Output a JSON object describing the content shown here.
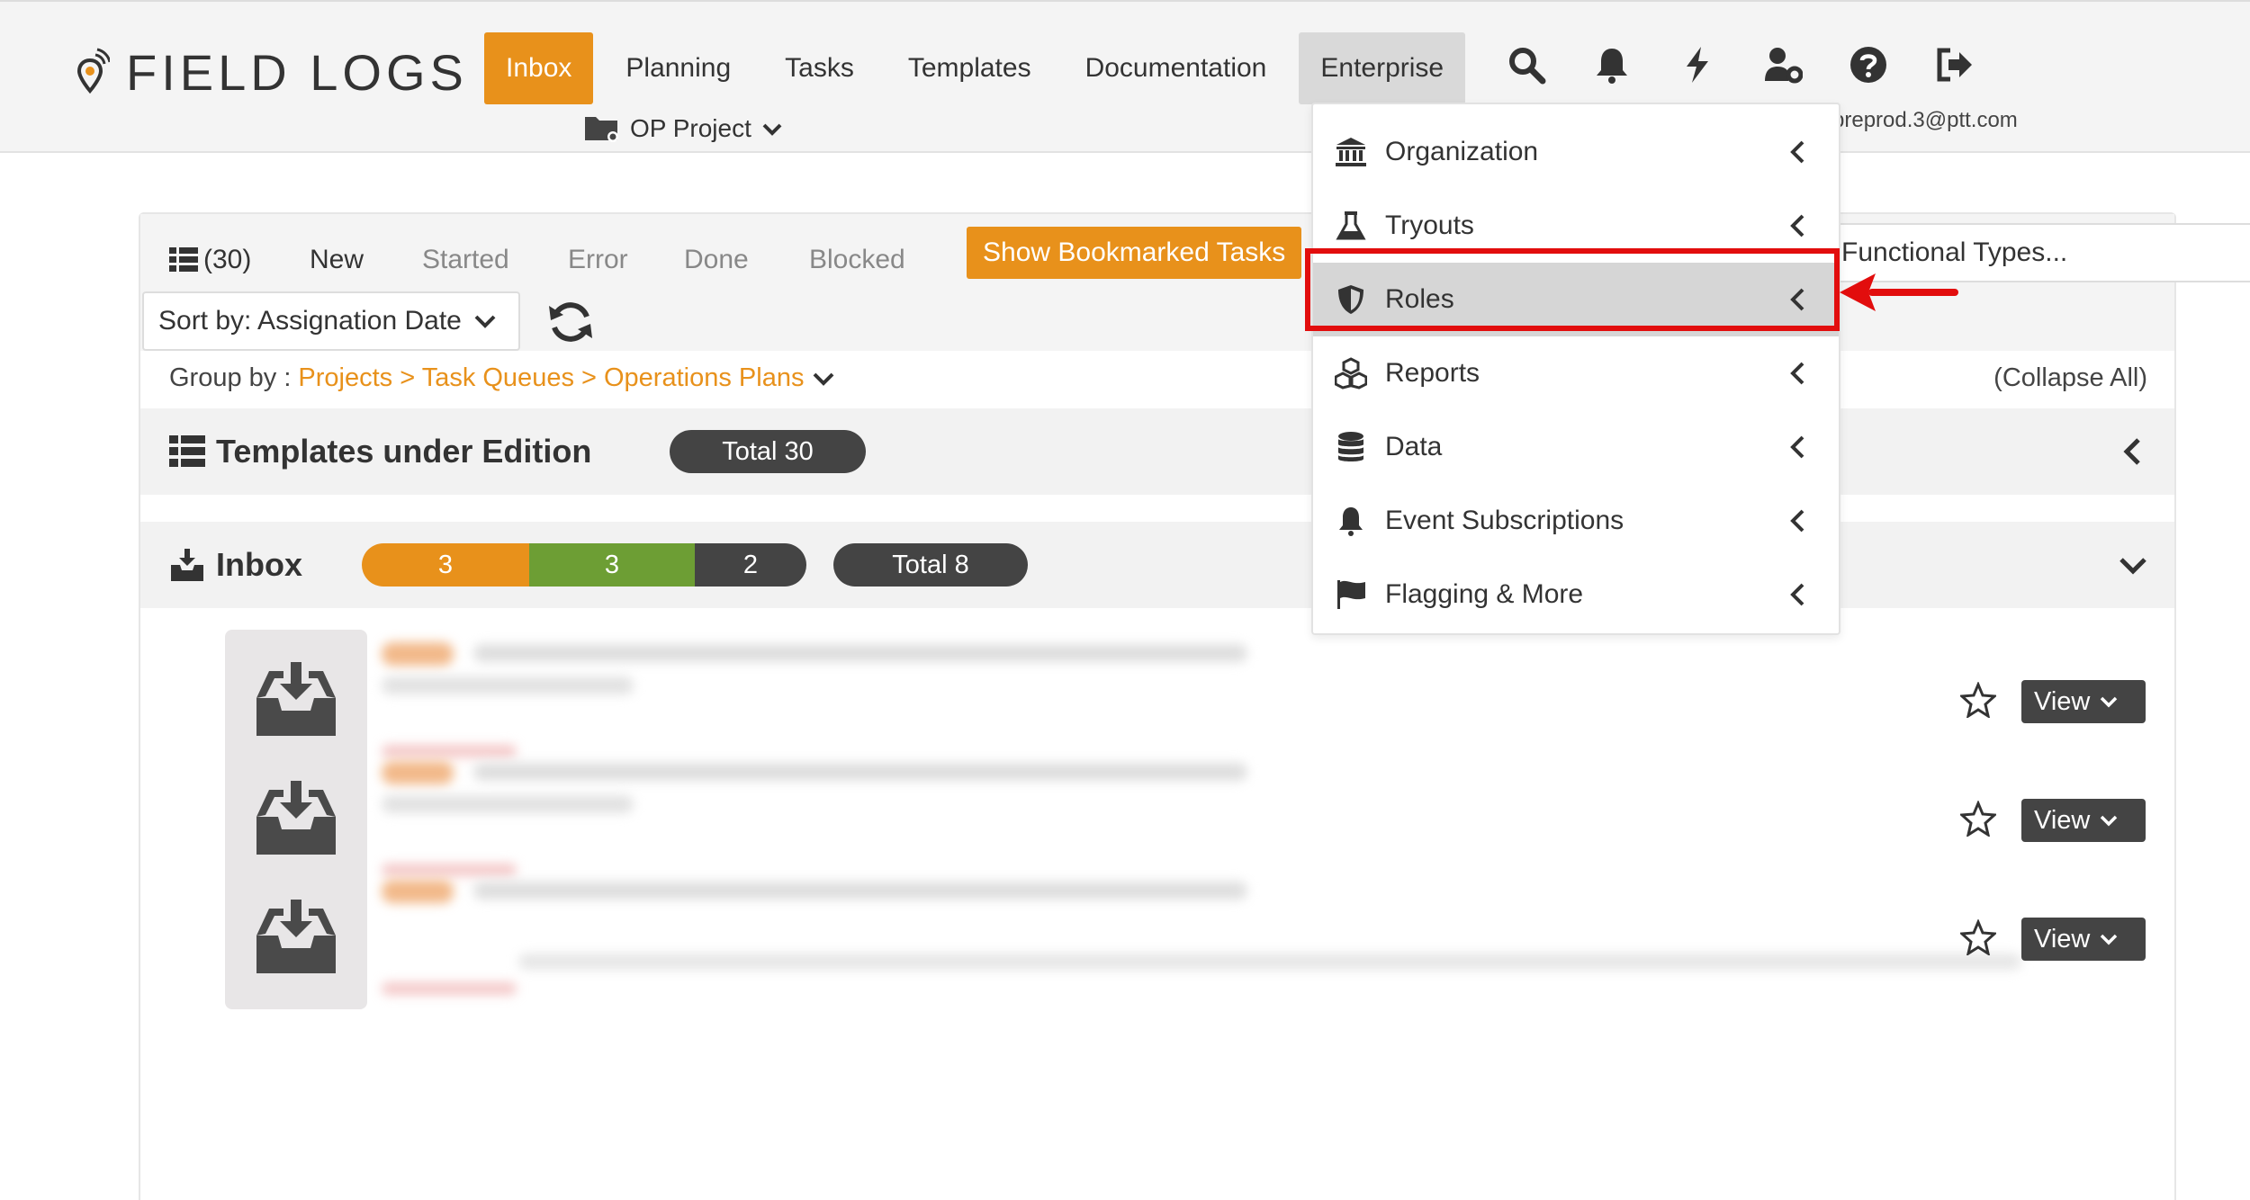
{
  "brand": {
    "name": "FIELD LOGS"
  },
  "nav": {
    "items": [
      {
        "label": "Inbox",
        "state": "active"
      },
      {
        "label": "Planning",
        "state": ""
      },
      {
        "label": "Tasks",
        "state": ""
      },
      {
        "label": "Templates",
        "state": ""
      },
      {
        "label": "Documentation",
        "state": ""
      },
      {
        "label": "Enterprise",
        "state": "open"
      }
    ],
    "icons": [
      "search-icon",
      "bell-icon",
      "bolt-icon",
      "user-settings-icon",
      "help-icon",
      "logout-icon"
    ]
  },
  "project": {
    "label": "OP Project"
  },
  "user": {
    "email_partial": "preprod.3@ptt.com"
  },
  "tabs": {
    "list_count": "(30)",
    "items": [
      "New",
      "Started",
      "Error",
      "Done",
      "Blocked"
    ],
    "active": "New",
    "bookmark_button": "Show Bookmarked Tasks",
    "functional_types": "Functional Types..."
  },
  "sort": {
    "label": "Sort by: Assignation Date"
  },
  "group_by": {
    "label": "Group by :",
    "path": "Projects > Task Queues > Operations Plans",
    "collapse_all": "(Collapse All)"
  },
  "sections": {
    "templates": {
      "title": "Templates under Edition",
      "total": "Total 30"
    },
    "inbox": {
      "title": "Inbox",
      "counts": [
        "3",
        "3",
        "2"
      ],
      "total": "Total 8"
    }
  },
  "task_rows": [
    {
      "view_label": "View"
    },
    {
      "view_label": "View"
    },
    {
      "view_label": "View"
    }
  ],
  "dropdown": {
    "items": [
      {
        "label": "Organization",
        "icon": "bank-icon"
      },
      {
        "label": "Tryouts",
        "icon": "flask-icon"
      },
      {
        "label": "Roles",
        "icon": "shield-icon",
        "highlighted": true
      },
      {
        "label": "Reports",
        "icon": "cubes-icon"
      },
      {
        "label": "Data",
        "icon": "database-icon"
      },
      {
        "label": "Event Subscriptions",
        "icon": "bell-icon"
      },
      {
        "label": "Flagging & More",
        "icon": "flag-icon"
      }
    ]
  },
  "colors": {
    "accent": "#e8911b",
    "green": "#6d9e34",
    "dark": "#444444",
    "highlight_box": "#e20d0d"
  }
}
